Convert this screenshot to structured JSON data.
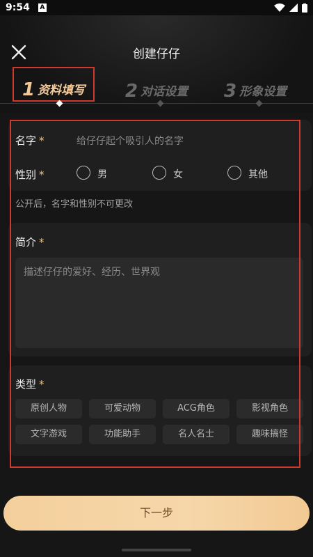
{
  "status": {
    "time": "9:54",
    "notif_icon": "A"
  },
  "header": {
    "title": "创建仔仔",
    "close_icon": "close-icon"
  },
  "steps": [
    {
      "num": "1",
      "label": "资料填写",
      "active": true
    },
    {
      "num": "2",
      "label": "对话设置",
      "active": false
    },
    {
      "num": "3",
      "label": "形象设置",
      "active": false
    }
  ],
  "form": {
    "name": {
      "label": "名字",
      "required": "*",
      "placeholder": "给仔仔起个吸引人的名字"
    },
    "gender": {
      "label": "性别",
      "required": "*",
      "options": [
        "男",
        "女",
        "其他"
      ]
    },
    "note": "公开后，名字和性别不可更改",
    "intro": {
      "label": "简介",
      "required": "*",
      "placeholder": "描述仔仔的爱好、经历、世界观"
    },
    "type": {
      "label": "类型",
      "required": "*",
      "tags": [
        "原创人物",
        "可爱动物",
        "ACG角色",
        "影视角色",
        "文字游戏",
        "功能助手",
        "名人名士",
        "趣味搞怪"
      ]
    }
  },
  "footer": {
    "next_label": "下一步"
  },
  "colors": {
    "accent": "#f3c99a",
    "highlight": "#d03a2e",
    "background": "#161616"
  }
}
